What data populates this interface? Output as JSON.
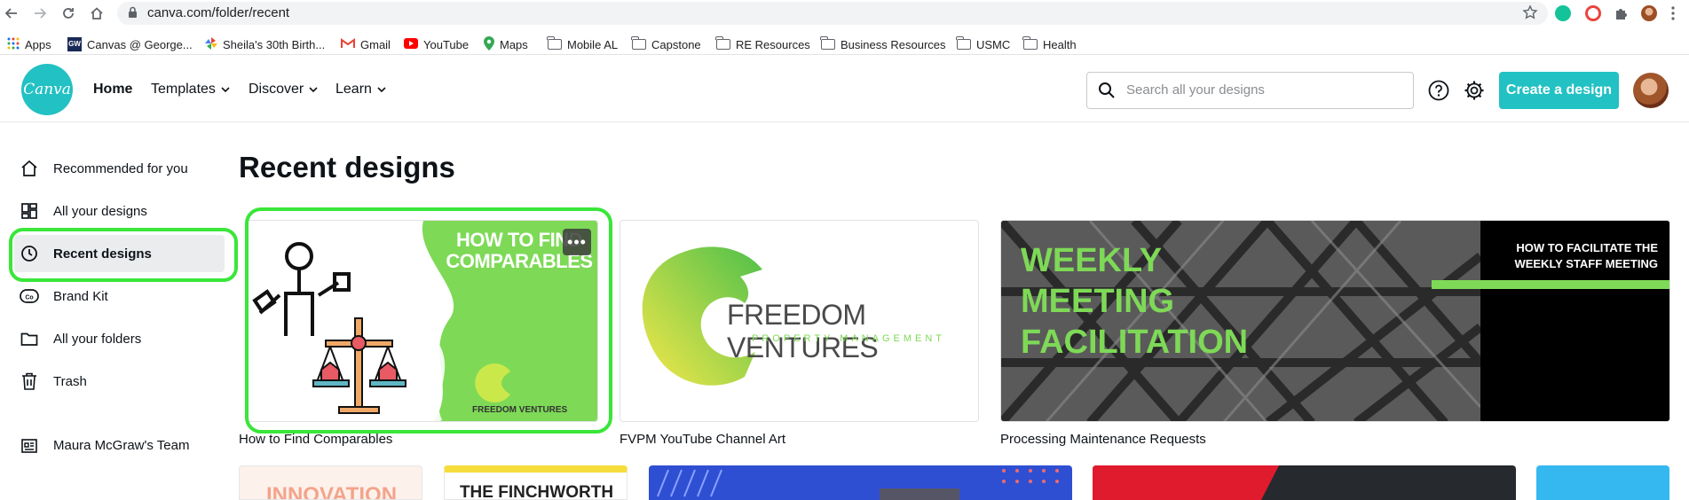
{
  "browser": {
    "url": "canva.com/folder/recent",
    "bookmarks": [
      {
        "label": "Apps",
        "icon": "apps-grid-icon"
      },
      {
        "label": "Canvas @ George...",
        "icon": "gw-logo-icon"
      },
      {
        "label": "Sheila's 30th Birth...",
        "icon": "pinwheel-icon"
      },
      {
        "label": "Gmail",
        "icon": "gmail-icon"
      },
      {
        "label": "YouTube",
        "icon": "youtube-icon"
      },
      {
        "label": "Maps",
        "icon": "maps-pin-icon"
      },
      {
        "label": "Mobile AL",
        "icon": "folder-icon"
      },
      {
        "label": "Capstone",
        "icon": "folder-icon"
      },
      {
        "label": "RE Resources",
        "icon": "folder-icon"
      },
      {
        "label": "Business Resources",
        "icon": "folder-icon"
      },
      {
        "label": "USMC",
        "icon": "folder-icon"
      },
      {
        "label": "Health",
        "icon": "folder-icon"
      }
    ]
  },
  "header": {
    "logo_text": "Canva",
    "nav": [
      {
        "label": "Home"
      },
      {
        "label": "Templates"
      },
      {
        "label": "Discover"
      },
      {
        "label": "Learn"
      }
    ],
    "search_placeholder": "Search all your designs",
    "create_label": "Create a design"
  },
  "sidebar": {
    "items": [
      {
        "label": "Recommended for you",
        "icon": "home-icon"
      },
      {
        "label": "All your designs",
        "icon": "grid-icon"
      },
      {
        "label": "Recent designs",
        "icon": "clock-icon",
        "active": true
      },
      {
        "label": "Brand Kit",
        "icon": "brand-kit-icon"
      },
      {
        "label": "All your folders",
        "icon": "folder-icon"
      },
      {
        "label": "Trash",
        "icon": "trash-icon"
      }
    ],
    "team": {
      "label": "Maura McGraw's Team",
      "icon": "team-icon"
    }
  },
  "main": {
    "title": "Recent designs",
    "designs": [
      {
        "caption": "How to Find Comparables",
        "thumb_heading_1": "HOW TO FIND",
        "thumb_heading_2": "COMPARABLES",
        "thumb_footer": "FREEDOM VENTURES"
      },
      {
        "caption": "FVPM YouTube Channel Art",
        "thumb_brand": "FREEDOM VENTURES",
        "thumb_tagline": "PROPERTY MANAGEMENT"
      },
      {
        "caption": "Processing Maintenance Requests",
        "thumb_line_1": "WEEKLY",
        "thumb_line_2": "MEETING",
        "thumb_line_3": "FACILITATION",
        "thumb_side_1": "HOW TO FACILITATE THE",
        "thumb_side_2": "WEEKLY STAFF MEETING"
      }
    ],
    "bottom_thumbs": [
      {
        "text": "INNOVATION"
      },
      {
        "text": "THE FINCHWORTH"
      }
    ]
  },
  "colors": {
    "accent": "#22c1c3",
    "highlight": "#39e639",
    "thumb_green": "#7ed957"
  }
}
